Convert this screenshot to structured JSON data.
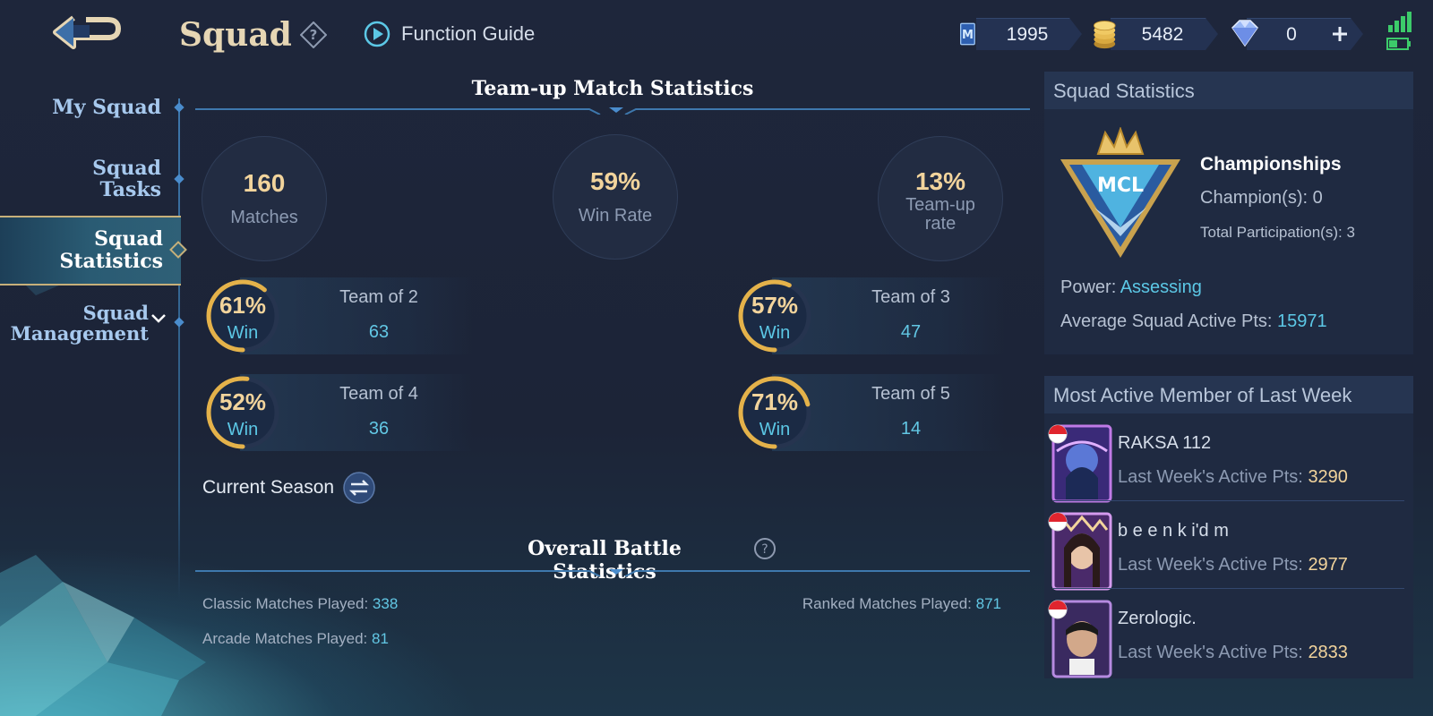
{
  "header": {
    "title": "Squad",
    "function_guide": "Function Guide",
    "currencies": [
      {
        "name": "ticket",
        "value": "1995",
        "icon": "ticket-icon"
      },
      {
        "name": "battle-points",
        "value": "5482",
        "icon": "coins-icon"
      },
      {
        "name": "diamonds",
        "value": "0",
        "icon": "diamond-icon"
      }
    ]
  },
  "sidebar": {
    "items": [
      {
        "label": "My Squad"
      },
      {
        "label": "Squad Tasks"
      },
      {
        "label": "Squad Statistics",
        "active": true
      },
      {
        "label": "Squad Management"
      }
    ]
  },
  "teamup": {
    "heading": "Team-up Match Statistics",
    "matches": {
      "value": "160",
      "label": "Matches"
    },
    "win_rate": {
      "value": "59%",
      "label": "Win Rate"
    },
    "teamup_rate": {
      "value": "13%",
      "label": "Team-up rate"
    },
    "teams": [
      {
        "pct": "61%",
        "fraction": 0.61,
        "win_label": "Win",
        "name": "Team of 2",
        "count": "63"
      },
      {
        "pct": "57%",
        "fraction": 0.57,
        "win_label": "Win",
        "name": "Team of 3",
        "count": "47"
      },
      {
        "pct": "52%",
        "fraction": 0.52,
        "win_label": "Win",
        "name": "Team of 4",
        "count": "36"
      },
      {
        "pct": "71%",
        "fraction": 0.71,
        "win_label": "Win",
        "name": "Team of 5",
        "count": "14"
      }
    ],
    "season_label": "Current Season"
  },
  "overall": {
    "heading": "Overall Battle Statistics",
    "classic_label": "Classic Matches Played:",
    "classic_value": "338",
    "ranked_label": "Ranked Matches Played:",
    "ranked_value": "871",
    "arcade_label": "Arcade Matches Played:",
    "arcade_value": "81"
  },
  "squad_stats": {
    "heading": "Squad Statistics",
    "emblem_text": "MCL",
    "championships_title": "Championships",
    "champions": "Champion(s): 0",
    "participations": "Total Participation(s): 3",
    "power_label": "Power:",
    "power_value": "Assessing",
    "avg_label": "Average Squad Active Pts:",
    "avg_value": "15971"
  },
  "active_members": {
    "heading": "Most Active Member of Last Week",
    "pts_label": "Last Week's Active Pts:",
    "members": [
      {
        "name": "RAKSA 112",
        "pts": "3290"
      },
      {
        "name": "b e e n k i'd m",
        "pts": "2977"
      },
      {
        "name": "Zerologic.",
        "pts": "2833"
      }
    ]
  },
  "colors": {
    "gold": "#f2d49c",
    "cyan": "#5cc8e6",
    "ring_gold": "#e4b24a"
  }
}
